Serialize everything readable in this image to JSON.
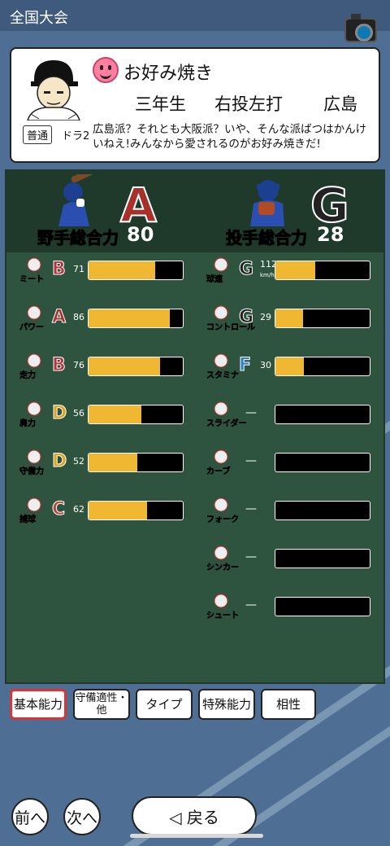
{
  "header": {
    "title": "全国大会"
  },
  "player": {
    "name": "お好み焼き",
    "year": "三年生",
    "handedness": "右投左打",
    "team": "広島",
    "badge": "普通",
    "draft": "ドラ2",
    "comment": "広島派？それとも大阪派？いや、そんな派ばつはかんけいねえ!みんなから愛されるのがお好み焼きだ!"
  },
  "batting": {
    "label": "野手総合力",
    "grade": "A",
    "total": "80",
    "stats": [
      {
        "label": "ミート",
        "grade": "B",
        "value": "71",
        "fill": 71
      },
      {
        "label": "パワー",
        "grade": "A",
        "value": "86",
        "fill": 86
      },
      {
        "label": "走力",
        "grade": "B",
        "value": "76",
        "fill": 76
      },
      {
        "label": "肩力",
        "grade": "D",
        "value": "56",
        "fill": 56
      },
      {
        "label": "守備力",
        "grade": "D",
        "value": "52",
        "fill": 52
      },
      {
        "label": "捕球",
        "grade": "C",
        "value": "62",
        "fill": 62
      }
    ]
  },
  "pitching": {
    "label": "投手総合力",
    "grade": "G",
    "total": "28",
    "stats": [
      {
        "label": "球速",
        "grade": "G",
        "value": "112",
        "unit": "km/h",
        "fill": 42
      },
      {
        "label": "コントロール",
        "grade": "G",
        "value": "29",
        "fill": 29
      },
      {
        "label": "スタミナ",
        "grade": "F",
        "value": "30",
        "fill": 30
      },
      {
        "label": "スライダー",
        "value": "—",
        "fill": 0
      },
      {
        "label": "カーブ",
        "value": "—",
        "fill": 0
      },
      {
        "label": "フォーク",
        "value": "—",
        "fill": 0
      },
      {
        "label": "シンカー",
        "value": "—",
        "fill": 0
      },
      {
        "label": "シュート",
        "value": "—",
        "fill": 0
      }
    ]
  },
  "tabs": [
    {
      "label": "基本能力",
      "active": true
    },
    {
      "label": "守備適性・他",
      "active": false
    },
    {
      "label": "タイプ",
      "active": false
    },
    {
      "label": "特殊能力",
      "active": false
    },
    {
      "label": "相性",
      "active": false
    }
  ],
  "nav": {
    "prev": "前へ",
    "next": "次へ",
    "back": "◁ 戻る"
  },
  "colors": {
    "gradeA": "#a8302a",
    "gradeB": "#b8323a",
    "gradeC": "#b8463a",
    "gradeD": "#e0a018",
    "gradeF": "#2c7cc8",
    "gradeG": "#222222",
    "bar": "#f0b832"
  }
}
